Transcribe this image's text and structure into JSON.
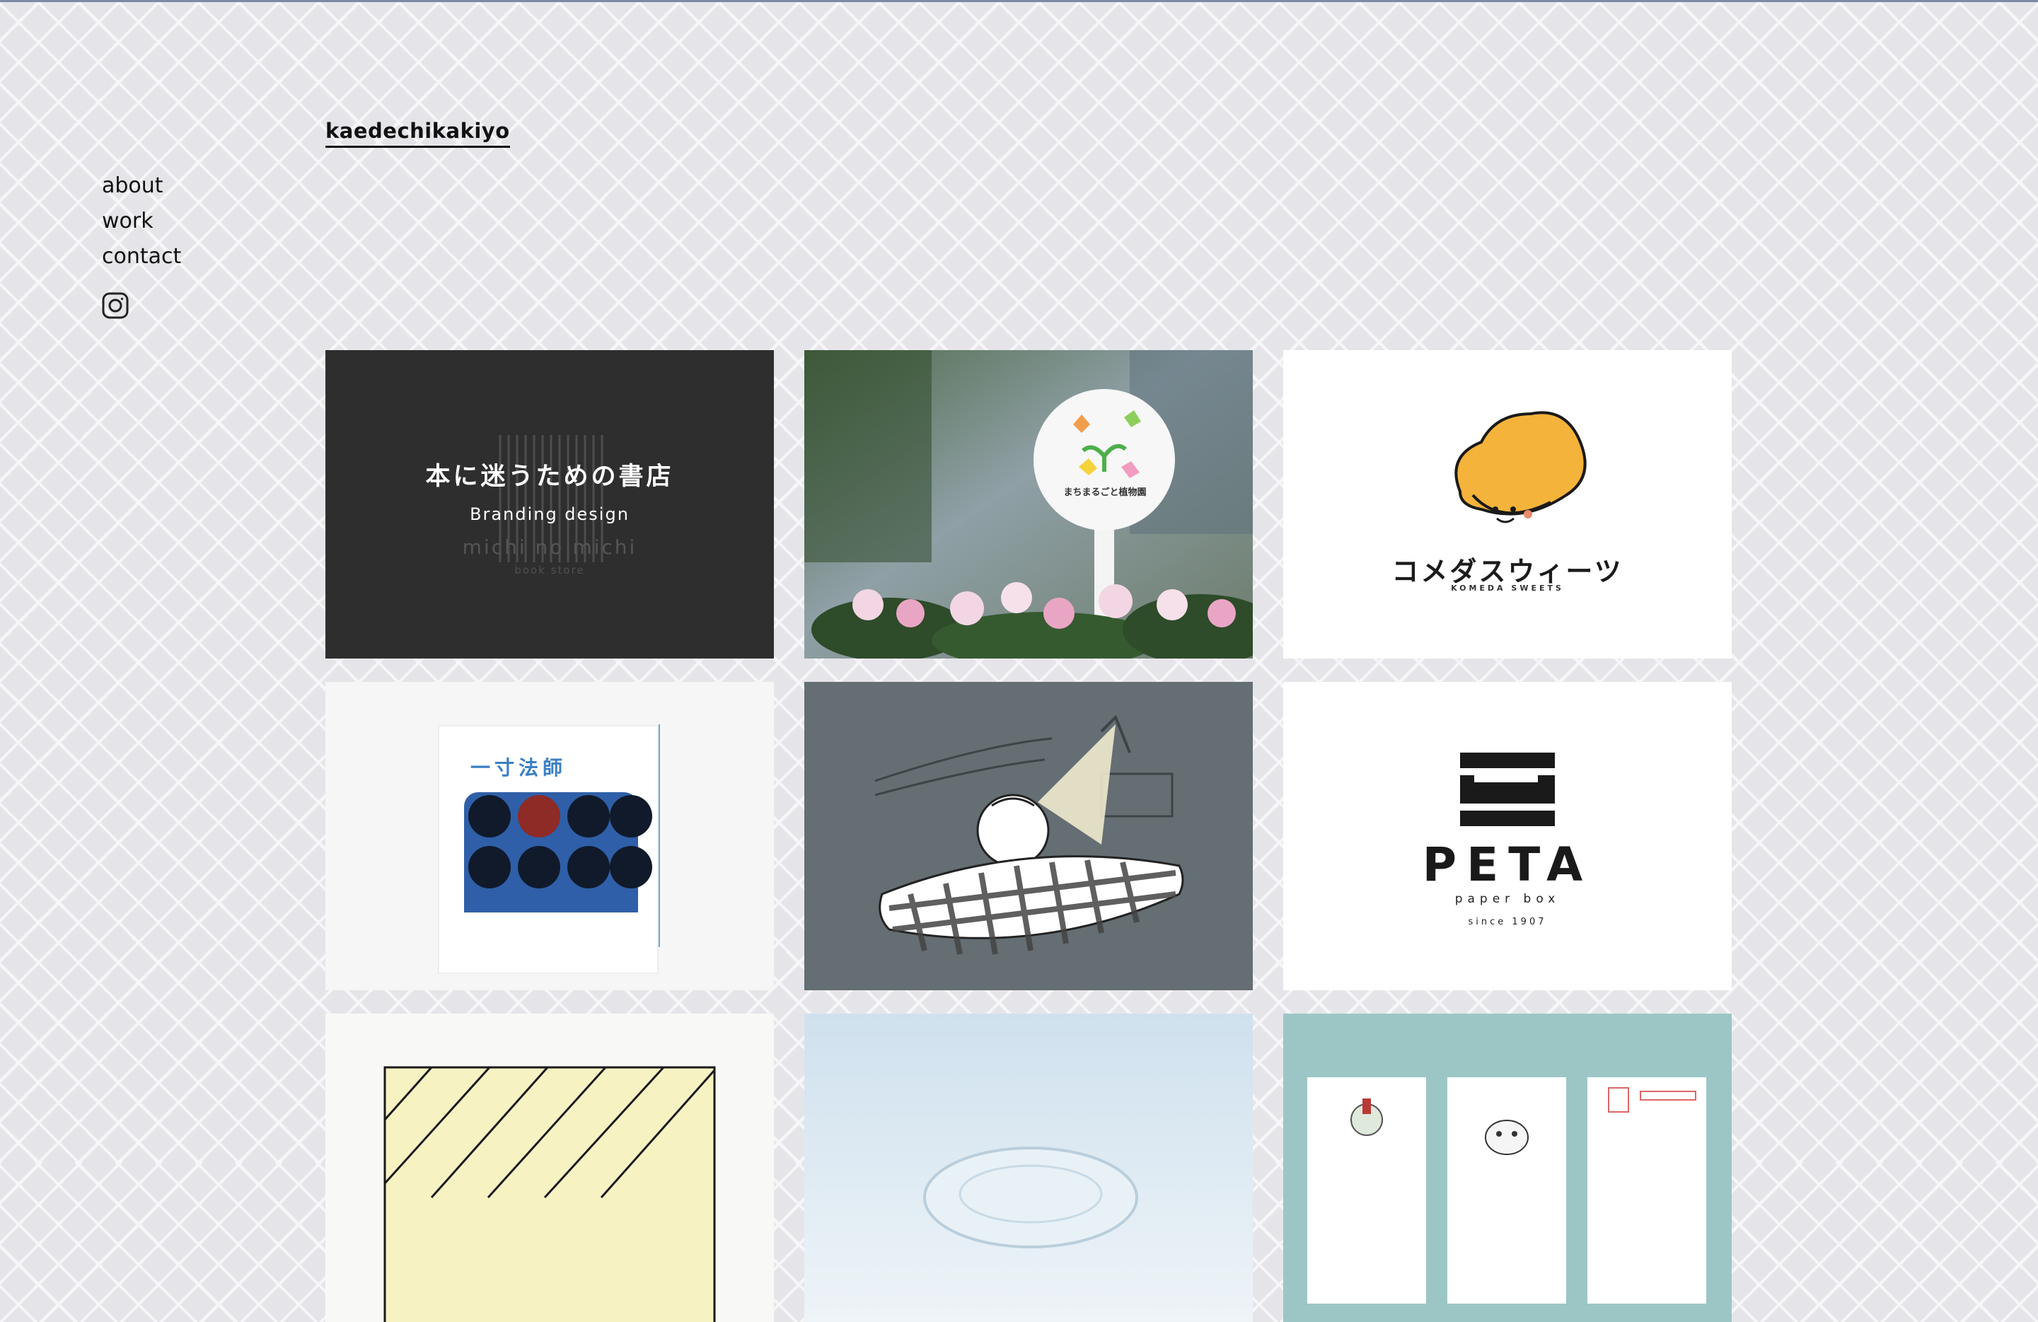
{
  "site": {
    "title": "kaedechikakiyo"
  },
  "nav": {
    "about": "about",
    "work": "work",
    "contact": "contact"
  },
  "icons": {
    "social": "instagram-icon"
  },
  "works": [
    {
      "title": "本に迷うための書店",
      "subtitle": "Branding design",
      "logo": "michi no michi",
      "logo_sub": "book store",
      "background": "#2e2e2e"
    },
    {
      "sign_text": "まちまるごと植物園"
    },
    {
      "name": "コメダスウィーツ",
      "name_en": "KOMEDA SWEETS"
    },
    {
      "book_title": "一寸法師"
    },
    {
      "description_icon": "sleeping-person-illustration",
      "background": "#646e73"
    },
    {
      "brand": "PETA",
      "tagline": "paper box",
      "since": "since 1907"
    },
    {
      "description_icon": "striped-box-illustration"
    },
    {
      "description_icon": "glass-dish-photo"
    },
    {
      "description_icon": "postcards-photo",
      "background": "#9cc6c6"
    }
  ]
}
